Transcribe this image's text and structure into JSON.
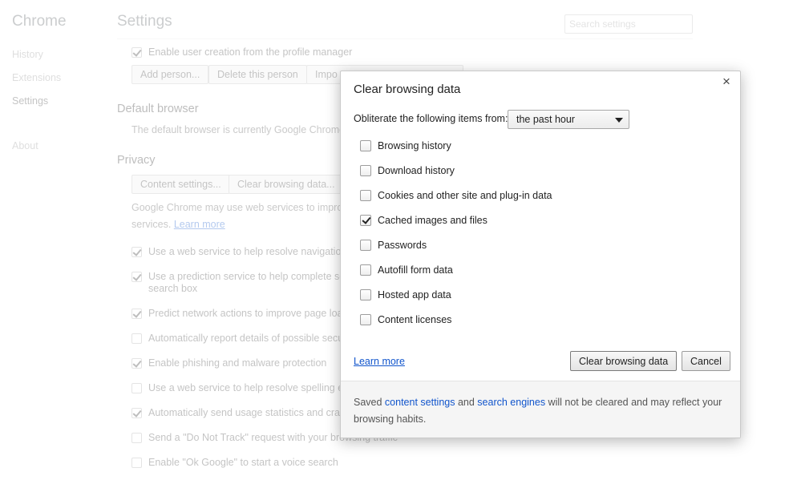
{
  "sidebar": {
    "title": "Chrome",
    "items": [
      {
        "label": "History"
      },
      {
        "label": "Extensions"
      },
      {
        "label": "Settings"
      },
      {
        "label": "About"
      }
    ]
  },
  "header": {
    "title": "Settings",
    "search_placeholder": "Search settings"
  },
  "people": {
    "enable_user_creation": "Enable user creation from the profile manager",
    "add_person": "Add person...",
    "delete_person": "Delete this person",
    "import_label": "Impo"
  },
  "default_browser": {
    "title": "Default browser",
    "text": "The default browser is currently Google Chrome."
  },
  "privacy": {
    "title": "Privacy",
    "content_settings": "Content settings...",
    "clear_browsing_data": "Clear browsing data...",
    "services_line1": "Google Chrome may use web services to improve",
    "services_line2_prefix": "services.",
    "learn_more": "Learn more",
    "options": [
      {
        "label": "Use a web service to help resolve navigation e",
        "checked": true
      },
      {
        "label": "Use a prediction service to help complete sea",
        "label2": "search box",
        "checked": true
      },
      {
        "label": "Predict network actions to improve page load",
        "checked": true
      },
      {
        "label": "Automatically report details of possible secur",
        "checked": false
      },
      {
        "label": "Enable phishing and malware protection",
        "checked": true
      },
      {
        "label": "Use a web service to help resolve spelling err",
        "checked": false
      },
      {
        "label": "Automatically send usage statistics and crash",
        "checked": true
      },
      {
        "label": "Send a \"Do Not Track\" request with your browsing traffic",
        "checked": false
      },
      {
        "label": "Enable \"Ok Google\" to start a voice search",
        "checked": false
      }
    ]
  },
  "dialog": {
    "title": "Clear browsing data",
    "close_symbol": "×",
    "period_label": "Obliterate the following items from:",
    "period_value": "the past hour",
    "items": [
      {
        "label": "Browsing history",
        "checked": false
      },
      {
        "label": "Download history",
        "checked": false
      },
      {
        "label": "Cookies and other site and plug-in data",
        "checked": false
      },
      {
        "label": "Cached images and files",
        "checked": true
      },
      {
        "label": "Passwords",
        "checked": false
      },
      {
        "label": "Autofill form data",
        "checked": false
      },
      {
        "label": "Hosted app data",
        "checked": false
      },
      {
        "label": "Content licenses",
        "checked": false
      }
    ],
    "learn_more": "Learn more",
    "clear_button": "Clear browsing data",
    "cancel_button": "Cancel",
    "footer": {
      "prefix": "Saved ",
      "link1": "content settings",
      "middle": " and ",
      "link2": "search engines",
      "suffix": " will not be cleared and may reflect your browsing habits."
    }
  }
}
